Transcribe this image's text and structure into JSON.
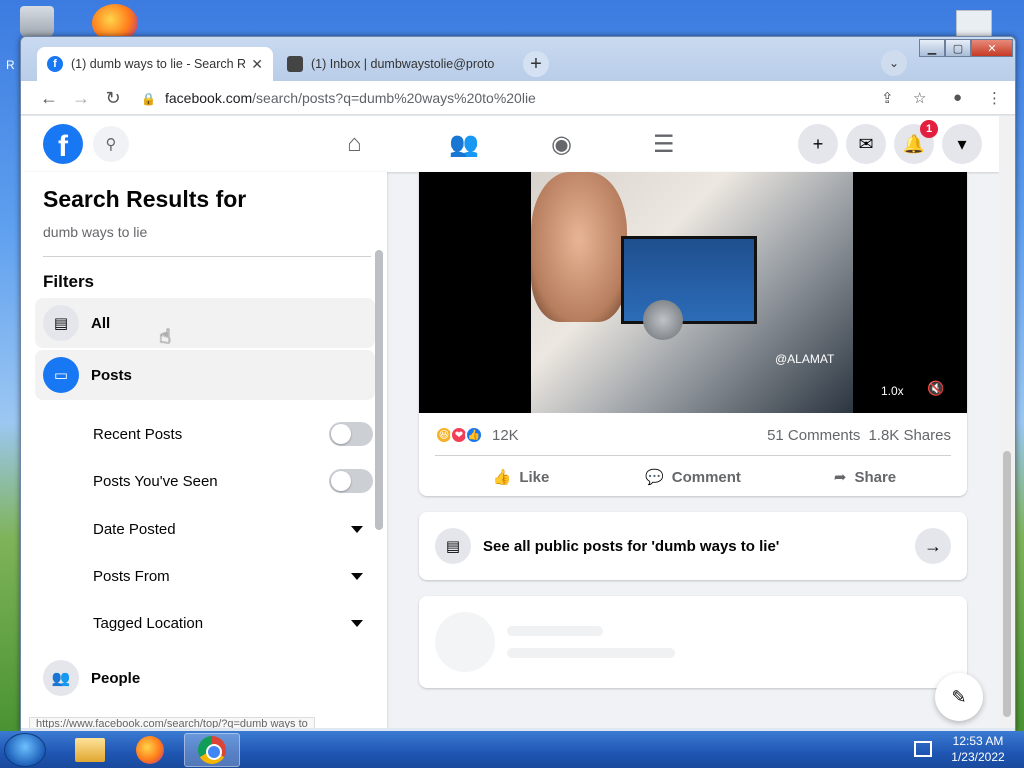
{
  "desktop": {
    "label_fragment": "R"
  },
  "browser": {
    "tabs": [
      {
        "title": "(1) dumb ways to lie - Search Res",
        "favicon": "f",
        "active": true
      },
      {
        "title": "(1) Inbox | dumbwaystolie@proto",
        "active": false
      }
    ],
    "new_tab_symbol": "+",
    "tab_search_symbol": "⌄",
    "window_buttons": {
      "minimize": "▁",
      "maximize": "▢",
      "close": "✕"
    },
    "nav": {
      "back": "←",
      "forward": "→",
      "reload": "↻"
    },
    "url_host": "facebook.com",
    "url_path": "/search/posts?q=dumb%20ways%20to%20lie",
    "toolbar_icons": {
      "share": "⇪",
      "star": "☆",
      "profile": "●",
      "menu": "⋮"
    }
  },
  "facebook": {
    "logo": "f",
    "notification_count": "1",
    "header_icons": {
      "search": "⚲",
      "home": "⌂",
      "friends": "👥",
      "groups": "◉",
      "menu": "☰",
      "create": "+",
      "messenger": "✉",
      "notifications": "🔔",
      "account": "▾"
    },
    "sidebar": {
      "title": "Search Results for",
      "query": "dumb ways to lie",
      "filters_heading": "Filters",
      "items": [
        {
          "label": "All",
          "icon": "▤"
        },
        {
          "label": "Posts",
          "icon": "▭"
        }
      ],
      "sub_filters": [
        {
          "label": "Recent Posts",
          "control": "toggle"
        },
        {
          "label": "Posts You've Seen",
          "control": "toggle"
        },
        {
          "label": "Date Posted",
          "control": "dropdown"
        },
        {
          "label": "Posts From",
          "control": "dropdown"
        },
        {
          "label": "Tagged Location",
          "control": "dropdown"
        }
      ],
      "people": {
        "label": "People",
        "icon": "👥"
      }
    },
    "post": {
      "video_watermark": "@ALAMAT",
      "video_speed": "1.0x",
      "video_mute": "🔇",
      "reaction_emojis": [
        "😆",
        "❤",
        "👍"
      ],
      "reactions_count": "12K",
      "comments": "51 Comments",
      "shares": "1.8K Shares",
      "actions": [
        {
          "label": "Like",
          "icon": "👍"
        },
        {
          "label": "Comment",
          "icon": "💬"
        },
        {
          "label": "Share",
          "icon": "➦"
        }
      ]
    },
    "see_all": {
      "text": "See all public posts for 'dumb ways to lie'",
      "icon": "▤",
      "arrow": "→"
    },
    "compose_icon": "✎",
    "status_url": "https://www.facebook.com/search/top/?q=dumb ways to"
  },
  "taskbar": {
    "time": "12:53 AM",
    "date": "1/23/2022"
  },
  "colors": {
    "fb_blue": "#1877f2",
    "badge_red": "#e41e3f",
    "text_primary": "#050505",
    "text_secondary": "#65676b"
  }
}
